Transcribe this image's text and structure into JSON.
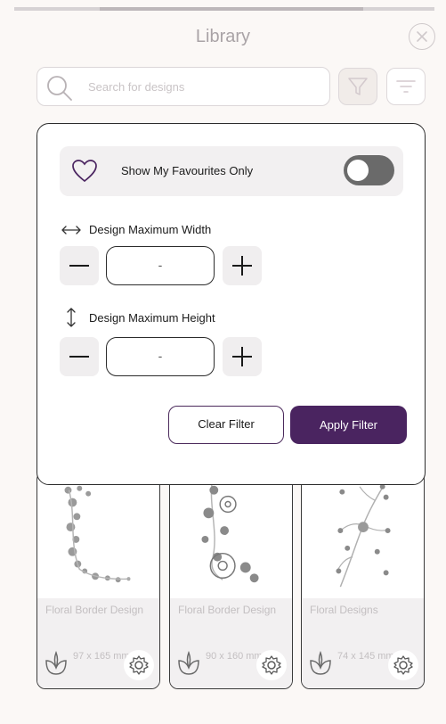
{
  "header": {
    "title": "Library"
  },
  "search": {
    "placeholder": "Search for designs"
  },
  "filter_panel": {
    "favourites_label": "Show My Favourites Only",
    "favourites_on": false,
    "width_label": "Design Maximum Width",
    "width_value": "-",
    "height_label": "Design Maximum Height",
    "height_value": "-",
    "clear_label": "Clear Filter",
    "apply_label": "Apply Filter"
  },
  "designs": [
    {
      "name": "Floral Border Design",
      "size": "97 x 165 mm"
    },
    {
      "name": "Floral Border Design",
      "size": "90 x 160 mm"
    },
    {
      "name": "Floral Designs",
      "size": "74 x 145 mm"
    }
  ],
  "colors": {
    "accent": "#4a2460",
    "toggle_off": "#6a6a6a"
  }
}
